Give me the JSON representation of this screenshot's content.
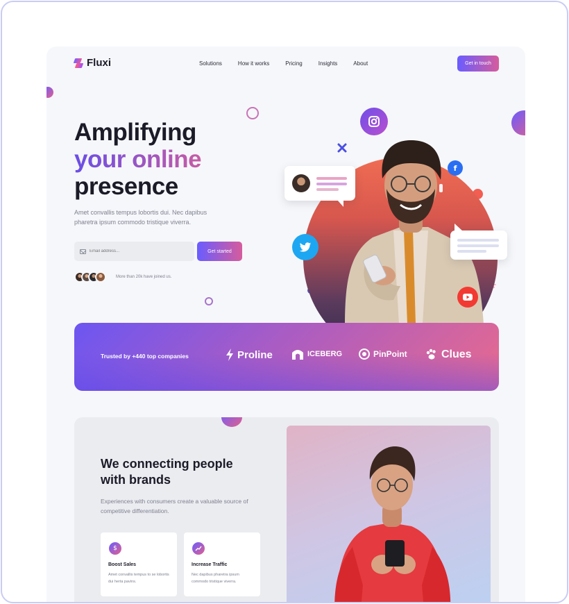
{
  "brand": {
    "name": "Fluxi"
  },
  "nav": {
    "items": [
      "Solutions",
      "How it works",
      "Pricing",
      "Insights",
      "About"
    ],
    "cta": "Get in touch"
  },
  "hero": {
    "title_line1": "Amplifying",
    "title_line2": "your online",
    "title_line3": "presence",
    "subtitle": "Amet convallis tempus lobortis dui. Nec dapibus pharetra ipsum commodo tristique viverra.",
    "email_placeholder": "Email address...",
    "button": "Get started",
    "joined_text": "More than 20k have joined us."
  },
  "trusted": {
    "label": "Trusted by +440 top companies",
    "brands": [
      "Proline",
      "ICEBERG",
      "PinPoint",
      "Clues"
    ]
  },
  "section2": {
    "title": "We connecting people with brands",
    "subtitle": "Experiences with consumers create a valuable source of competitive differentiation.",
    "cards": [
      {
        "icon": "dollar-icon",
        "title": "Boost Sales",
        "text": "Amet convallis tempus to se lobortis dui herta pavins."
      },
      {
        "icon": "trend-up-icon",
        "title": "Increase Traffic",
        "text": "Nec dapibus pharetra ipsum commodo tristique viverra."
      }
    ]
  },
  "colors": {
    "accent_start": "#6a5cff",
    "accent_end": "#d65c9d",
    "page_bg": "#f6f7fa",
    "frame_border": "#c9ccf3"
  }
}
